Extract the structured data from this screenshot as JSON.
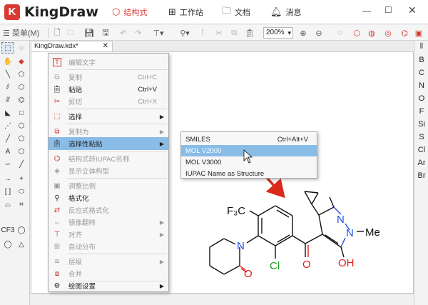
{
  "app": {
    "name": "KingDraw",
    "logo_letter": "K"
  },
  "nav": [
    {
      "label": "结构式",
      "icon": "hexagon-icon",
      "active": true
    },
    {
      "label": "工作站",
      "icon": "grid-icon"
    },
    {
      "label": "文档",
      "icon": "folder-icon"
    },
    {
      "label": "消息",
      "icon": "bell-icon"
    }
  ],
  "toolbar": {
    "menu_label": "菜单(M)",
    "zoom": "200%"
  },
  "doc_tab": {
    "title": "KingDraw.kdx*"
  },
  "left_tools": {
    "cf3_label": "CF3"
  },
  "elements": [
    "B",
    "C",
    "N",
    "O",
    "F",
    "Si",
    "S",
    "Cl",
    "Ar",
    "Br"
  ],
  "context_menu": {
    "items": [
      {
        "label": "编辑文字",
        "shortcut": "",
        "disabled": true,
        "submenu": false,
        "icon": "T"
      },
      {
        "label": "复制",
        "shortcut": "Ctrl+C",
        "disabled": true,
        "submenu": false,
        "icon": "⧉"
      },
      {
        "label": "粘贴",
        "shortcut": "Ctrl+V",
        "disabled": false,
        "submenu": false,
        "icon": "📋"
      },
      {
        "label": "剪切",
        "shortcut": "Ctrl+X",
        "disabled": true,
        "submenu": false,
        "icon": "✂"
      },
      {
        "label": "选择",
        "shortcut": "",
        "disabled": false,
        "submenu": true,
        "icon": "⬚"
      },
      {
        "label": "复制为",
        "shortcut": "",
        "disabled": true,
        "submenu": true,
        "icon": "⧉"
      },
      {
        "label": "选择性粘贴",
        "shortcut": "",
        "disabled": false,
        "submenu": true,
        "icon": "📋",
        "highlighted": true
      },
      {
        "label": "结构式转IUPAC名称",
        "shortcut": "",
        "disabled": true,
        "submenu": false,
        "icon": "⌬"
      },
      {
        "label": "显示立体构型",
        "shortcut": "",
        "disabled": true,
        "submenu": false,
        "icon": "◈"
      },
      {
        "label": "调整比例",
        "shortcut": "",
        "disabled": true,
        "submenu": false,
        "icon": "▣"
      },
      {
        "label": "格式化",
        "shortcut": "",
        "disabled": false,
        "submenu": false,
        "icon": "⚲"
      },
      {
        "label": "反应式格式化",
        "shortcut": "",
        "disabled": true,
        "submenu": false,
        "icon": "⇄"
      },
      {
        "label": "镜像翻转",
        "shortcut": "",
        "disabled": true,
        "submenu": true,
        "icon": "⇔"
      },
      {
        "label": "对齐",
        "shortcut": "",
        "disabled": true,
        "submenu": true,
        "icon": "⊤"
      },
      {
        "label": "自动分布",
        "shortcut": "",
        "disabled": true,
        "submenu": false,
        "icon": "⊞"
      },
      {
        "label": "层级",
        "shortcut": "",
        "disabled": true,
        "submenu": true,
        "icon": "≋"
      },
      {
        "label": "合并",
        "shortcut": "",
        "disabled": true,
        "submenu": false,
        "icon": "⧈"
      },
      {
        "label": "绘图设置",
        "shortcut": "",
        "disabled": false,
        "submenu": true,
        "icon": "⚙"
      }
    ]
  },
  "submenu": {
    "items": [
      {
        "label": "SMILES",
        "shortcut": "Ctrl+Alt+V"
      },
      {
        "label": "MOL V2000",
        "shortcut": "",
        "highlighted": true
      },
      {
        "label": "MOL V3000",
        "shortcut": ""
      },
      {
        "label": "IUPAC Name as Structure",
        "shortcut": ""
      }
    ]
  },
  "molecule": {
    "atoms": {
      "f3c": "F₃C",
      "n_ring": "N",
      "o_ketone": "O",
      "cl": "Cl",
      "o_carbonyl": "O",
      "n1": "N",
      "n2": "N",
      "me": "Me",
      "oh": "OH"
    },
    "colors": {
      "n": "#1f4fe0",
      "o": "#e01f1f",
      "cl": "#1a9a1a",
      "bond": "#111111"
    }
  },
  "colors": {
    "accent": "#d93a30",
    "highlight": "#89bde8",
    "arrow": "#d92a1c"
  }
}
